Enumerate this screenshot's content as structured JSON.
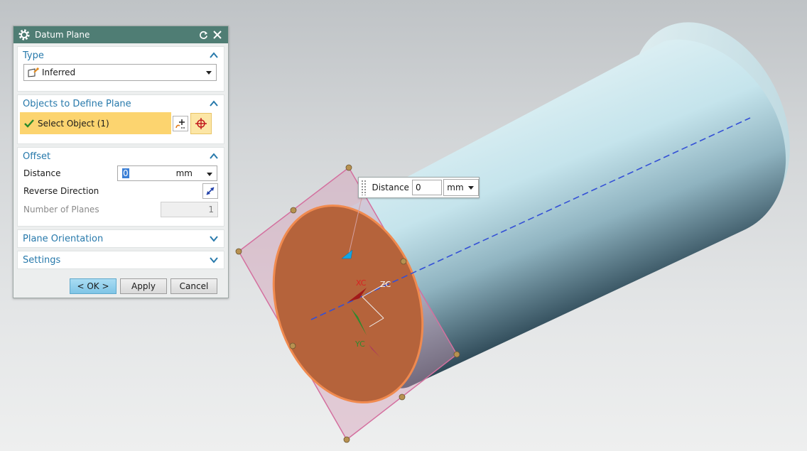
{
  "dialog": {
    "title": "Datum Plane",
    "type_group": {
      "label": "Type",
      "selected": "Inferred"
    },
    "objects_group": {
      "label": "Objects to Define Plane",
      "select_object": "Select Object (1)"
    },
    "offset_group": {
      "label": "Offset",
      "distance_label": "Distance",
      "distance_value": "0",
      "distance_unit": "mm",
      "reverse_label": "Reverse Direction",
      "planes_label": "Number of Planes",
      "planes_value": "1"
    },
    "orientation_group": {
      "label": "Plane Orientation"
    },
    "settings_group": {
      "label": "Settings"
    },
    "buttons": {
      "ok": "< OK >",
      "apply": "Apply",
      "cancel": "Cancel"
    }
  },
  "float_widget": {
    "label": "Distance",
    "value": "0",
    "unit": "mm"
  },
  "axes": {
    "x": "XC",
    "y": "YC",
    "z": "ZC"
  },
  "colors": {
    "title_bar": "#4f7d74",
    "group_label": "#2779ab",
    "selection_highlight": "#fcd46f",
    "face": "#b5633b",
    "datum_plane": "#d28fae",
    "axis_line": "#3450d6"
  }
}
